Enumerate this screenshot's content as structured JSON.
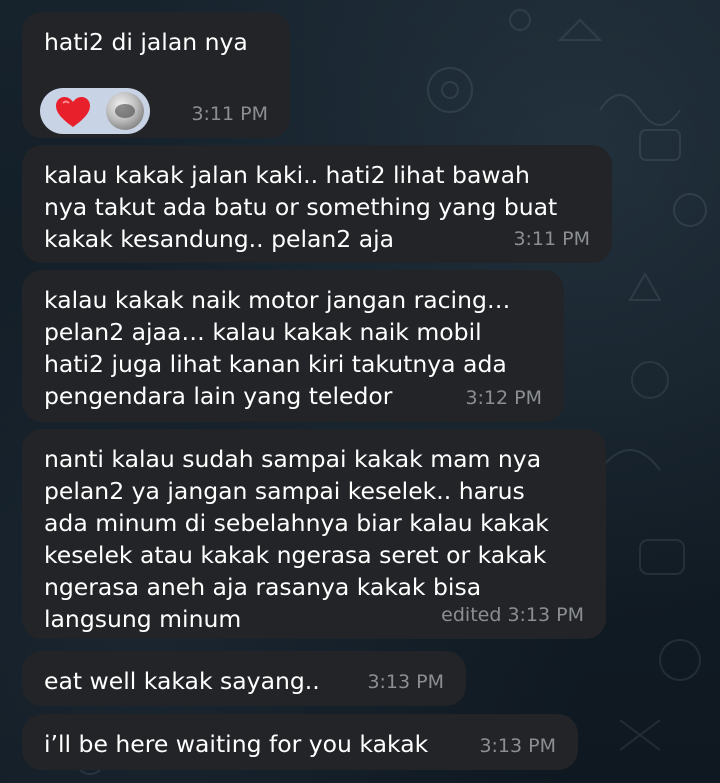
{
  "colors": {
    "bubble_bg": "#222427",
    "text": "#ffffff",
    "timestamp": "#8b8e93",
    "reaction_pill": "#c8d3e6",
    "heart": "#e8202c"
  },
  "messages": [
    {
      "text": "hati2 di jalan nya",
      "time": "3:11 PM",
      "reactions": [
        {
          "icon": "red-heart-icon"
        },
        {
          "icon": "reactor-avatar"
        }
      ]
    },
    {
      "text": "kalau kakak jalan kaki.. hati2 lihat bawah\nnya takut ada batu or something yang buat\nkakak kesandung.. pelan2 aja",
      "time": "3:11 PM"
    },
    {
      "text": "kalau kakak naik motor jangan racing…\npelan2 ajaa… kalau kakak naik mobil\nhati2 juga lihat kanan kiri takutnya ada\npengendara lain yang teledor",
      "time": "3:12 PM"
    },
    {
      "text": "nanti kalau sudah sampai kakak mam nya\npelan2 ya jangan sampai keselek.. harus\nada minum di sebelahnya biar kalau kakak\nkeselek atau kakak ngerasa seret or kakak\nngerasa aneh aja rasanya kakak bisa\nlangsung minum",
      "time": "edited 3:13 PM"
    },
    {
      "text": "eat well kakak sayang..",
      "time": "3:13 PM"
    },
    {
      "text": "i’ll be here waiting for you kakak",
      "time": "3:13 PM"
    }
  ]
}
